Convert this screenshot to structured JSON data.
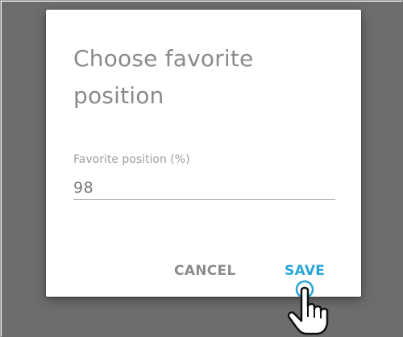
{
  "dialog": {
    "title": "Choose favorite position",
    "field": {
      "label": "Favorite position (%)",
      "value": "98"
    },
    "actions": {
      "cancel_label": "CANCEL",
      "save_label": "SAVE"
    }
  },
  "colors": {
    "backdrop": "#6d6d6d",
    "dialog_background": "#ffffff",
    "title_text": "#8a8a8a",
    "cancel_text": "#8c8c8c",
    "accent": "#2aa6d6"
  },
  "pointer": {
    "icon": "hand-pointer-icon"
  }
}
